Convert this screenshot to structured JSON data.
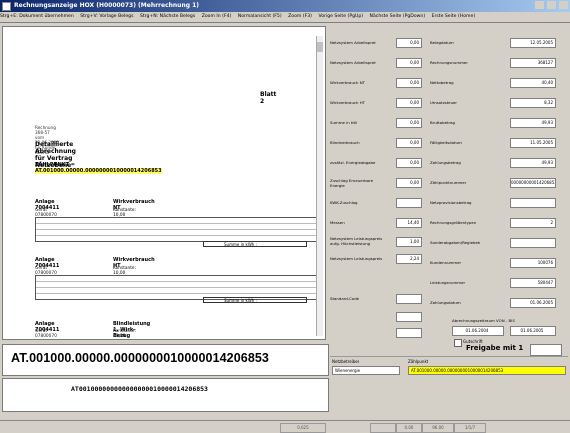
{
  "window": {
    "title": "Rechnungsanzeige HOX (H0000073) (Mehrrechnung 1)"
  },
  "menu": [
    "Strg+E: Dokument übernehmen",
    "Strg+V: Vorlage Belegs",
    "Strg+N: Nächste Belegs",
    "Zoom In (F4)",
    "Normalansicht (F5)",
    "Zoom (F3)",
    "Vorige Seite (PgUp)",
    "Nächste Seite (PgDown)",
    "Erste Seite (Home)"
  ],
  "document": {
    "blatt": "Blatt 2",
    "line1": "Rechnung   368-57   vom 12.06.2005   für Kunde: KELAG",
    "heading": "Detaillierte Abrechnung für Vertrag   Netzebene 7",
    "zahlpunkt_label": "ZÄHLPUNKT =",
    "zahlpunkt_value": "AT.001000.00000.0000000010000014206853",
    "sections": [
      {
        "anlage": "Anlage  7004411",
        "geraet": "Gerät  07800070",
        "title": "Wirkverbrauch NT",
        "konst": "Konstante: 10,00"
      },
      {
        "anlage": "Anlage  7004411",
        "geraet": "Gerät  07800070",
        "title": "Wirkverbrauch HT",
        "konst": "Konstante: 10,00"
      },
      {
        "anlage": "Anlage  7004411",
        "geraet": "Gerät  07800070",
        "title": "Blindleistung 1. Wirk-Bezug",
        "konst": "Konstante: 10,00"
      }
    ],
    "summe_label": "Summe in kWh :"
  },
  "big_zahlpunkt": "AT.001000.00000.0000000010000014206853",
  "barcode_text": "AT001000000000000000010000014206853",
  "fields_left": [
    {
      "label": "Netzsystem Arbeitspreis NT",
      "value": "0,00"
    },
    {
      "label": "Netzsystem Arbeitspreis HT",
      "value": "0,00"
    },
    {
      "label": "Wirkverbrauch NT",
      "value": "0,00"
    },
    {
      "label": "Wirkverbrauch HT",
      "value": "0,00"
    },
    {
      "label": "Summe in kW",
      "value": "0,00"
    },
    {
      "label": "Blindverbrauch",
      "value": "0,00"
    },
    {
      "label": "zusätzl. Energieabgabe",
      "value": "0,00"
    },
    {
      "label": "Zuschlag Erneuerbare Energie",
      "value": "0,00"
    },
    {
      "label": "KWK-Zuschlag",
      "value": ""
    },
    {
      "label": "Messen",
      "value": "14,40"
    },
    {
      "label": "Netzsystem Leistungspreis aufg. Höchstleistung",
      "value": "1,00"
    },
    {
      "label": "Netzsystem Leistungspreis",
      "value": "2,24"
    },
    {
      "label": "Standard-Code",
      "value": ""
    }
  ],
  "fields_right": [
    {
      "label": "Belegdatum",
      "value": "12.05.2005"
    },
    {
      "label": "Rechnungsnummer",
      "value": "368127"
    },
    {
      "label": "Nettobetrag",
      "value": "40,40"
    },
    {
      "label": "Umsatzsteuer",
      "value": "8,32"
    },
    {
      "label": "Bruttobetrag",
      "value": "49,93"
    },
    {
      "label": "Fälligkeitsdatum",
      "value": "11.05.2005"
    },
    {
      "label": "Zahlungsbetrag",
      "value": "49,93"
    },
    {
      "label": "Zählpunktnummer",
      "value": "000000000014206853"
    },
    {
      "label": "Netzprovisionsbetrag",
      "value": ""
    },
    {
      "label": "Rechnungsgrößentypen",
      "value": "2"
    },
    {
      "label": "Sonderabgaben/Regiebetrag",
      "value": ""
    },
    {
      "label": "Kundennummer",
      "value": "100076"
    },
    {
      "label": "Leistungsnummer",
      "value": "580447"
    },
    {
      "label": "Zahlungsdatum",
      "value": "01.06.2005"
    }
  ],
  "abrechnungszeitraum": {
    "label": "Abrechnungszeitraum VON - BIS",
    "von": "01.06.2004",
    "bis": "01.06.2005"
  },
  "gutschrift_label": "Gutschrift",
  "freigabe": {
    "label": "Freigabe mit 1",
    "value": ""
  },
  "bottom": {
    "netzbetreiber_label": "Netzbetreiber",
    "netzbetreiber_value": "Wienenergie",
    "zaehlpunkt_label": "Zählpunkt",
    "zaehlpunkt_value": "AT.001000.00000.0000000010000014206853"
  },
  "status": [
    "0,625",
    "",
    "0.00",
    "96.00",
    "1/1/7"
  ],
  "colors": {
    "highlight": "#ffff66",
    "titlebar": "#0a246a"
  }
}
